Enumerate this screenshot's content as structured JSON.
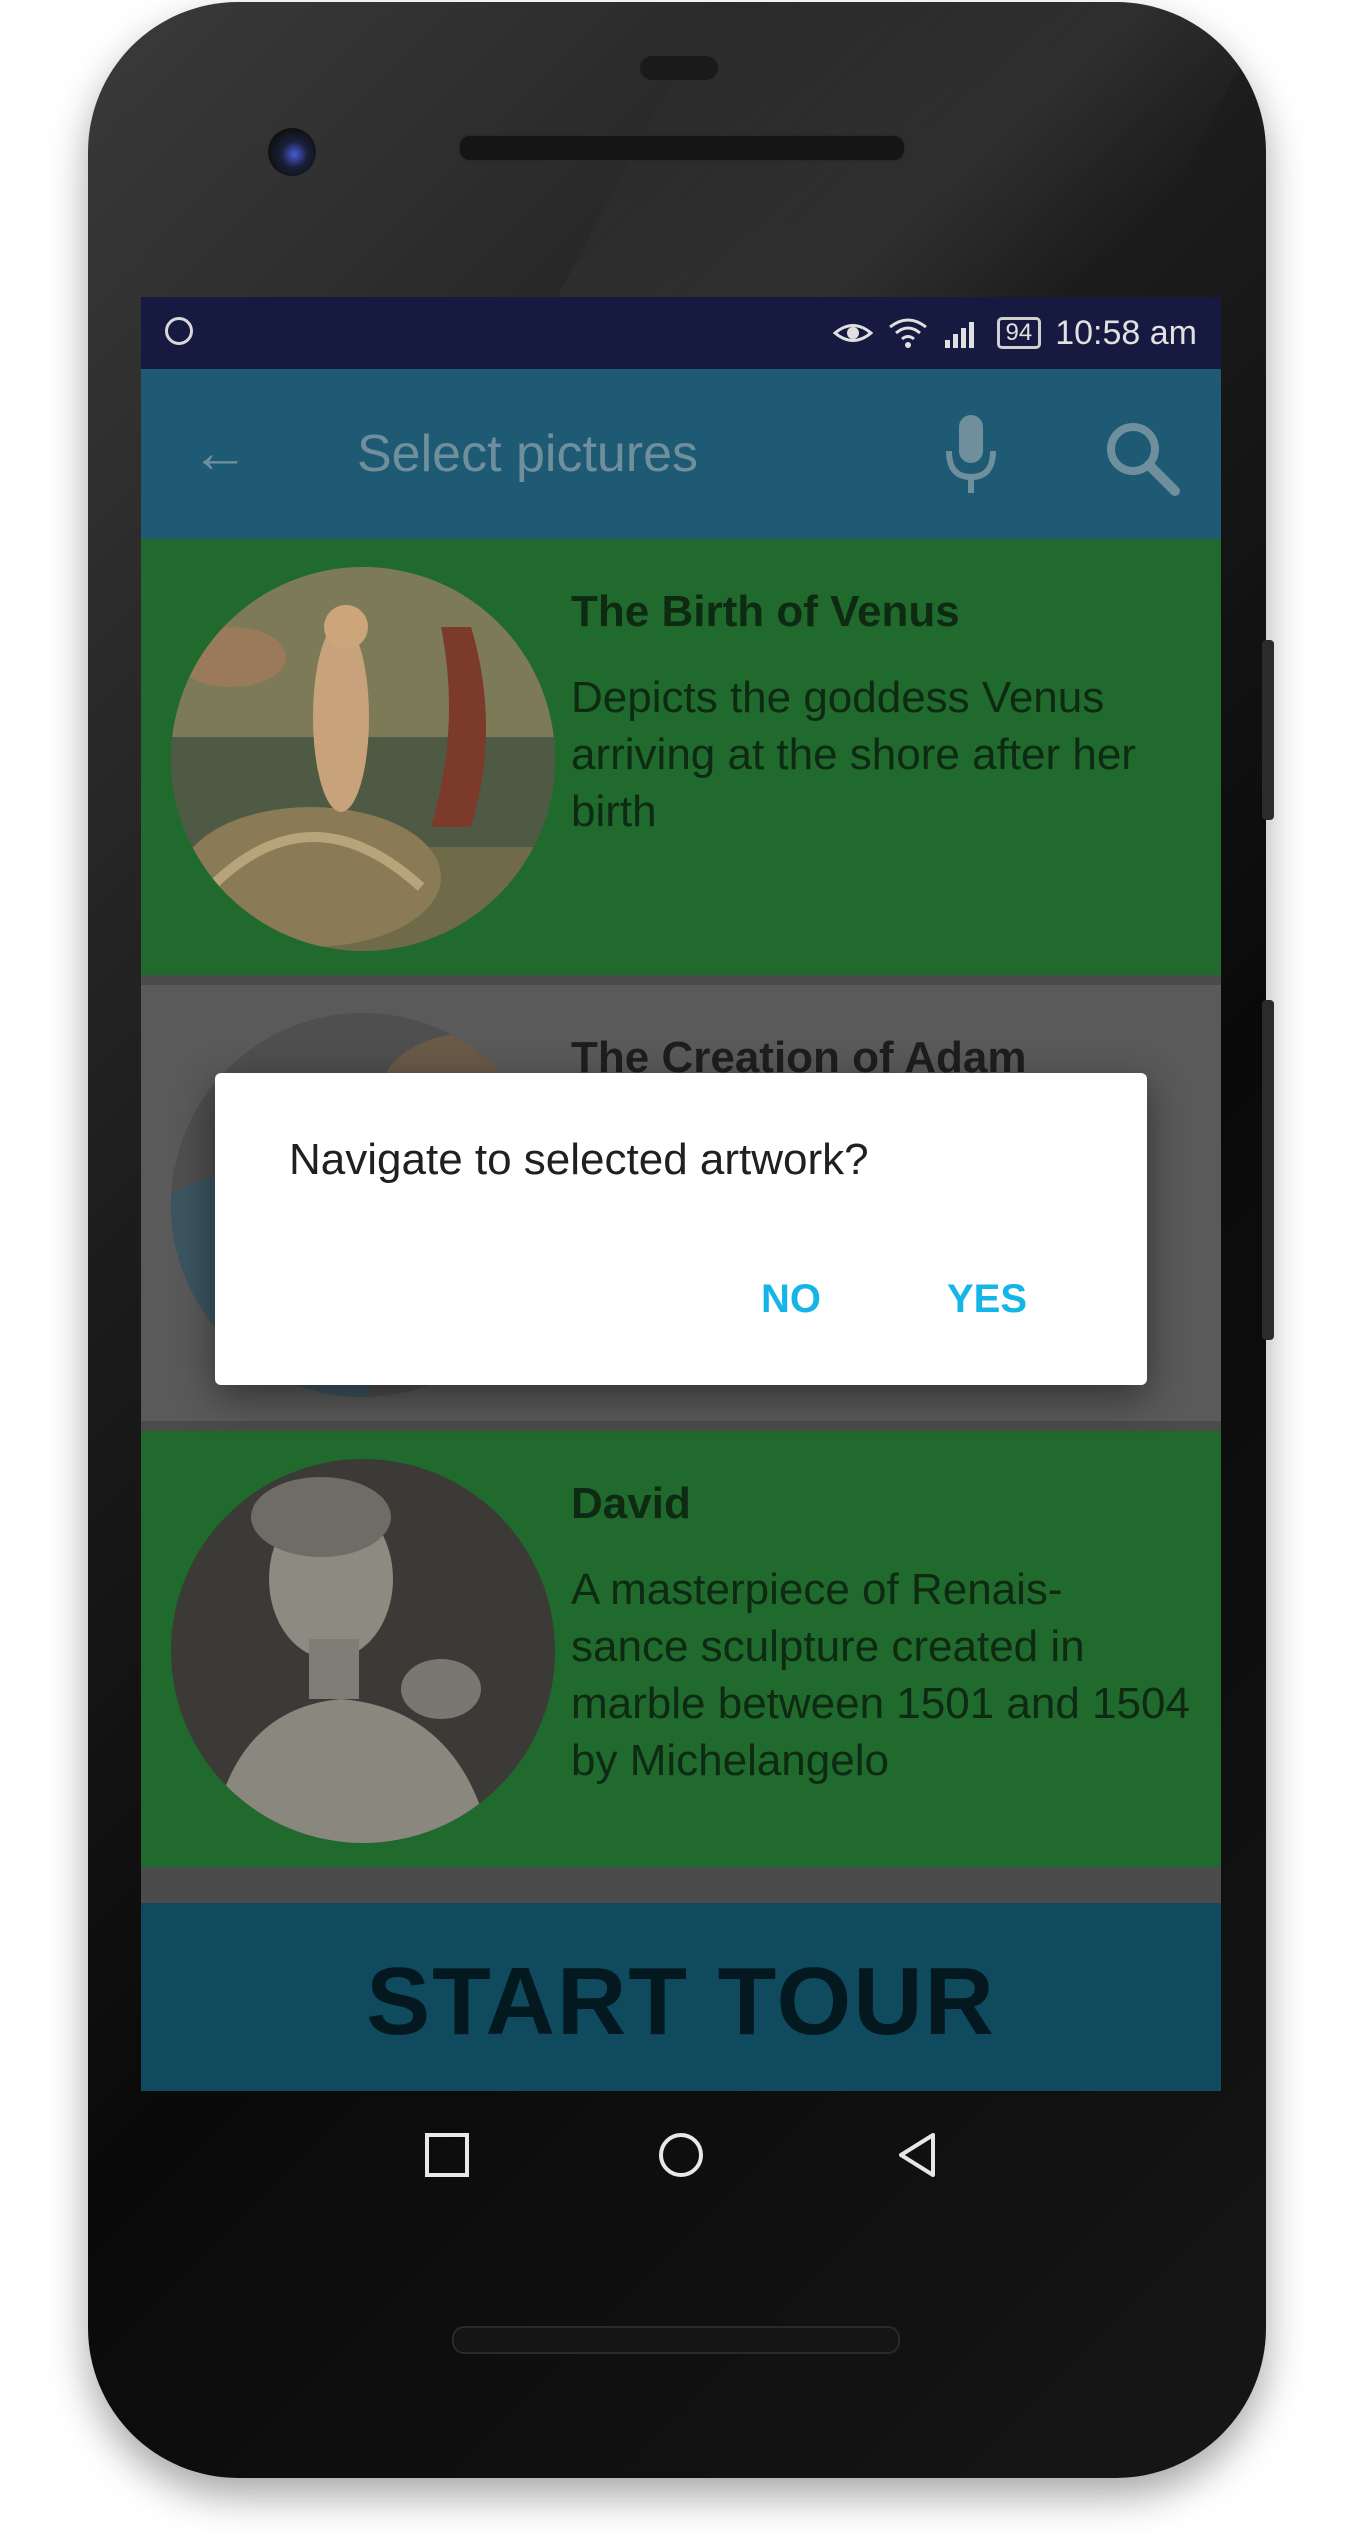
{
  "status_bar": {
    "time": "10:58 am",
    "battery": "94",
    "icons": [
      "sync-circle-icon",
      "eye-icon",
      "wifi-icon",
      "signal-icon",
      "battery-icon"
    ]
  },
  "app_bar": {
    "title": "Select pictures",
    "back_icon": "arrow-left-icon",
    "mic_icon": "microphone-icon",
    "search_icon": "search-icon"
  },
  "artworks": [
    {
      "title": "The Birth of Venus",
      "description": "Depicts the goddess Venus arriving at the shore after her birth"
    },
    {
      "title": "The Creation of Adam",
      "description": ""
    },
    {
      "title": "David",
      "description": "A masterpiece of Renais- sance sculpture created in marble between 1501 and 1504 by Michelangelo"
    }
  ],
  "start_button": {
    "label": "START TOUR"
  },
  "dialog": {
    "message": "Navigate to selected artwork?",
    "no_label": "NO",
    "yes_label": "YES",
    "accent": "#16b5e8"
  },
  "nav_bar": {
    "icons": [
      "recents-square-icon",
      "home-circle-icon",
      "back-triangle-icon"
    ]
  },
  "colors": {
    "status_bar": "#161a40",
    "app_bar": "#1e5a73",
    "card_green": "#1f6a2c",
    "start_button": "#0f4a5e"
  }
}
